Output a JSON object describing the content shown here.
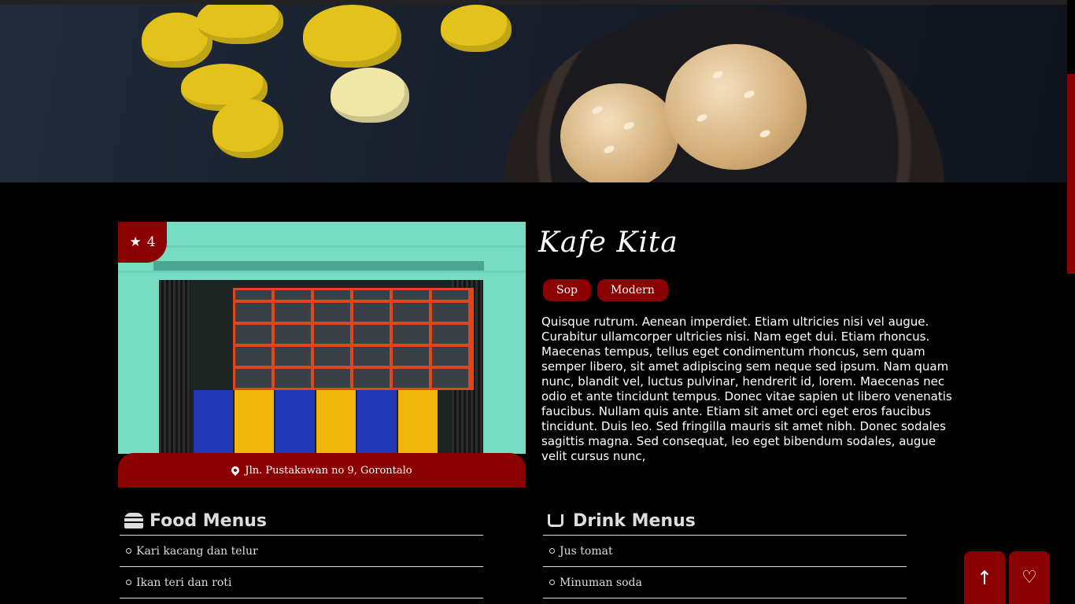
{
  "hero": {
    "image": "cookies-and-daffodils-photo"
  },
  "shop": {
    "rating_icon": "star-icon",
    "rating": "4",
    "photo": "storefront-photo",
    "address_icon": "map-pin-icon",
    "address": "Jln. Pustakawan no 9, Gorontalo",
    "title": "Kafe Kita",
    "tags": [
      "Sop",
      "Modern"
    ],
    "description": "Quisque rutrum. Aenean imperdiet. Etiam ultricies nisi vel augue. Curabitur ullamcorper ultricies nisi. Nam eget dui. Etiam rhoncus. Maecenas tempus, tellus eget condimentum rhoncus, sem quam semper libero, sit amet adipiscing sem neque sed ipsum. Nam quam nunc, blandit vel, luctus pulvinar, hendrerit id, lorem. Maecenas nec odio et ante tincidunt tempus. Donec vitae sapien ut libero venenatis faucibus. Nullam quis ante. Etiam sit amet orci eget eros faucibus tincidunt. Duis leo. Sed fringilla mauris sit amet nibh. Donec sodales sagittis magna. Sed consequat, leo eget bibendum sodales, augue velit cursus nunc,"
  },
  "food_menu": {
    "icon": "burger-icon",
    "title": "Food Menus",
    "items": [
      "Kari kacang dan telur",
      "Ikan teri dan roti"
    ]
  },
  "drink_menu": {
    "icon": "coffee-cup-icon",
    "title": "Drink Menus",
    "items": [
      "Jus tomat",
      "Minuman soda"
    ]
  },
  "buttons": {
    "up_icon": "arrow-up-icon",
    "favorite_icon": "heart-icon"
  },
  "colors": {
    "accent": "#8b0000",
    "background": "#000000",
    "text": "#ffffff"
  }
}
